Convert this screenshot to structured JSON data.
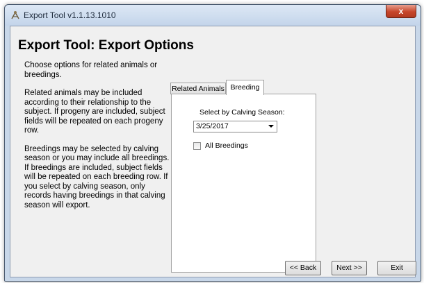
{
  "window": {
    "title": "Export Tool v1.1.13.1010",
    "close_label": "x"
  },
  "page": {
    "heading": "Export Tool:   Export Options",
    "help_paragraphs": [
      "Choose options for related animals or breedings.",
      "Related animals may be included according to their relationship to the subject.  If progeny are included, subject fields will be repeated on each progeny row.",
      "Breedings may be selected by calving season or you may include all breedings.  If breedings are included, subject fields will be repeated on each breeding row.  If you select by calving season, only records having breedings in that calving season will export."
    ]
  },
  "tabs": [
    {
      "label": "Related Animals",
      "active": false
    },
    {
      "label": "Breeding",
      "active": true
    }
  ],
  "breeding_tab": {
    "calving_label": "Select by Calving Season:",
    "calving_value": "3/25/2017",
    "all_breedings_label": "All Breedings",
    "all_breedings_checked": false
  },
  "buttons": {
    "back": "<< Back",
    "next": "Next >>",
    "exit": "Exit"
  }
}
